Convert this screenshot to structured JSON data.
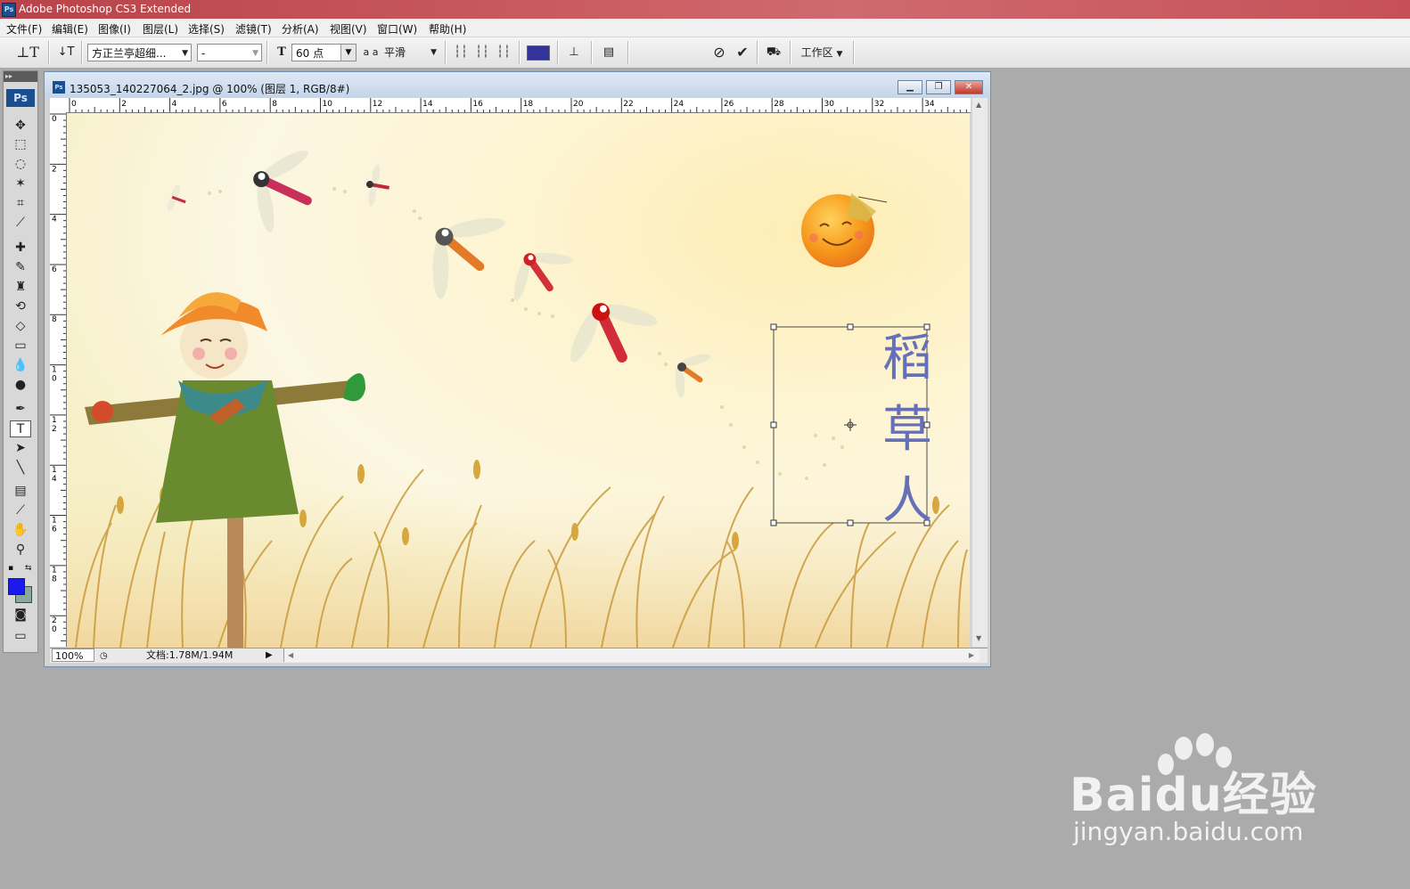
{
  "app": {
    "title": "Adobe Photoshop CS3 Extended",
    "logo": "Ps"
  },
  "menu": [
    "文件(F)",
    "编辑(E)",
    "图像(I)",
    "图层(L)",
    "选择(S)",
    "滤镜(T)",
    "分析(A)",
    "视图(V)",
    "窗口(W)",
    "帮助(H)"
  ],
  "options": {
    "font_family": "方正兰亭超细...",
    "font_style": "-",
    "font_size": "60 点",
    "antialias_label": "a a",
    "antialias": "平滑",
    "text_color": "#333399",
    "workspace": "工作区"
  },
  "toolbox": {
    "logo": "Ps",
    "tools": [
      "move-tool",
      "marquee-tool",
      "lasso-tool",
      "magic-wand-tool",
      "crop-tool",
      "slice-tool",
      "healing-brush-tool",
      "brush-tool",
      "clone-stamp-tool",
      "history-brush-tool",
      "eraser-tool",
      "gradient-tool",
      "blur-tool",
      "dodge-tool",
      "pen-tool",
      "type-tool",
      "path-selection-tool",
      "line-tool",
      "notes-tool",
      "eyedropper-tool",
      "hand-tool",
      "zoom-tool"
    ],
    "foreground": "#1a1aee",
    "background": "#88aa99"
  },
  "document": {
    "title": "135053_140227064_2.jpg @ 100% (图层 1, RGB/8#)",
    "ruler_top": [
      "0",
      "2",
      "4",
      "6",
      "8",
      "10",
      "12",
      "14",
      "16",
      "18",
      "20",
      "22",
      "24",
      "26",
      "28",
      "30",
      "32",
      "34"
    ],
    "ruler_left": [
      "0",
      "2",
      "4",
      "6",
      "8",
      "1 0",
      "1 2",
      "1 4",
      "1 6",
      "1 8",
      "2 0"
    ],
    "vertical_text": [
      "稻",
      "草",
      "人"
    ],
    "text_color": "#6670b8"
  },
  "status": {
    "zoom": "100%",
    "doc_size": "文档:1.78M/1.94M"
  },
  "watermark": {
    "brand": "Baidu经验",
    "url": "jingyan.baidu.com"
  }
}
